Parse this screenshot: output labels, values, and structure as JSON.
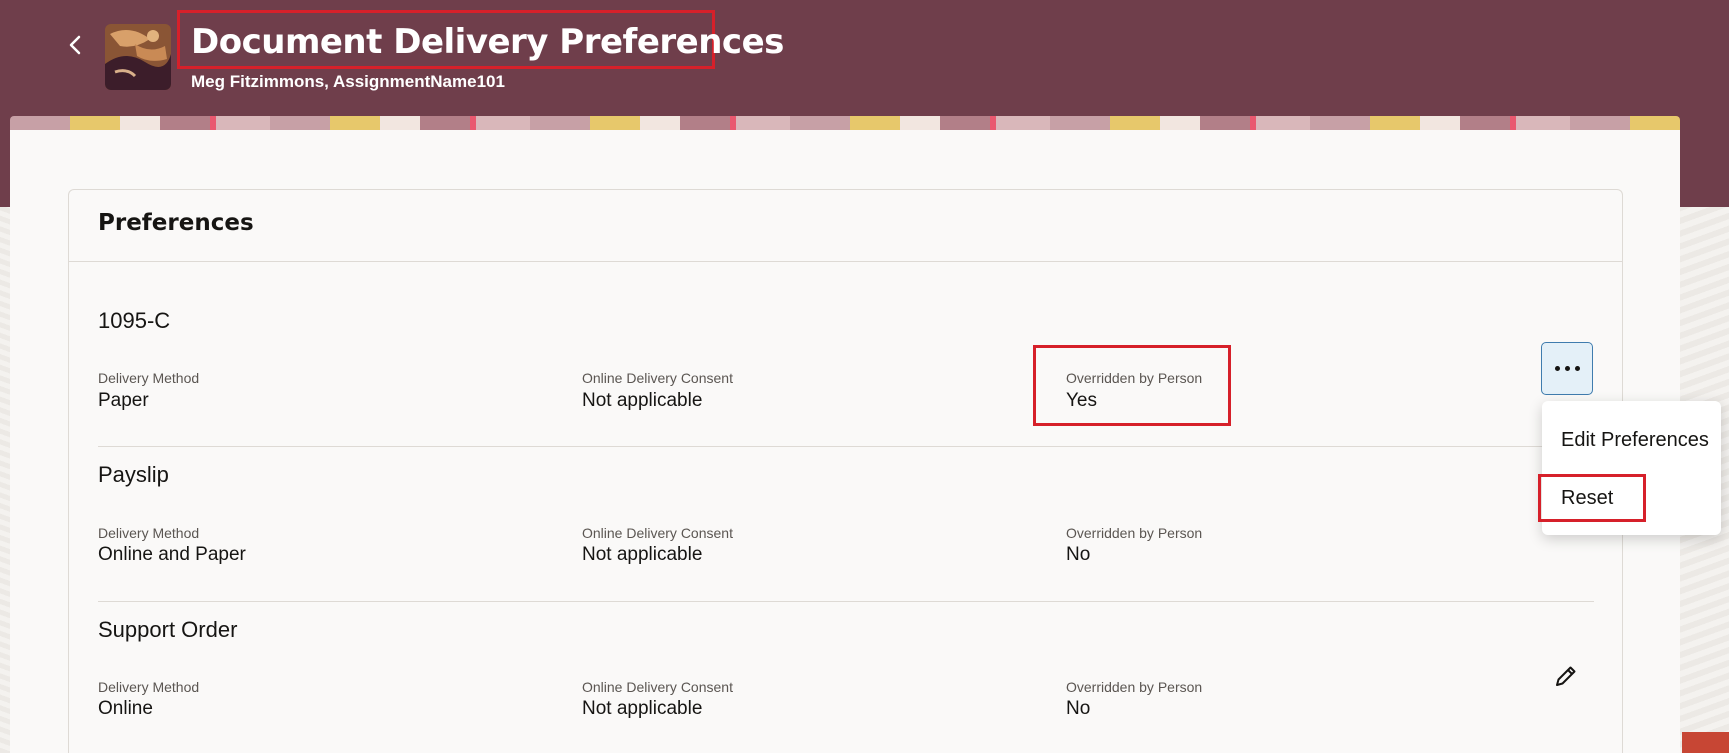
{
  "header": {
    "title": "Document Delivery Preferences",
    "subtitle": "Meg Fitzimmons, AssignmentName101"
  },
  "section": {
    "title": "Preferences"
  },
  "labels": {
    "delivery_method": "Delivery Method",
    "online_consent": "Online Delivery Consent",
    "overridden": "Overridden by Person"
  },
  "documents": [
    {
      "name": "1095-C",
      "delivery_method": "Paper",
      "online_consent": "Not applicable",
      "overridden": "Yes"
    },
    {
      "name": "Payslip",
      "delivery_method": "Online and Paper",
      "online_consent": "Not applicable",
      "overridden": "No"
    },
    {
      "name": "Support Order",
      "delivery_method": "Online",
      "online_consent": "Not applicable",
      "overridden": "No"
    }
  ],
  "actions_menu": {
    "items": [
      "Edit Preferences",
      "Reset"
    ]
  },
  "colors": {
    "header_bg": "#6f3e4b",
    "highlight": "#d6202a",
    "more_button_bg": "#e4f0f8"
  },
  "icons": {
    "back": "chevron-left-icon",
    "more": "more-actions-icon",
    "edit": "pencil-icon"
  }
}
